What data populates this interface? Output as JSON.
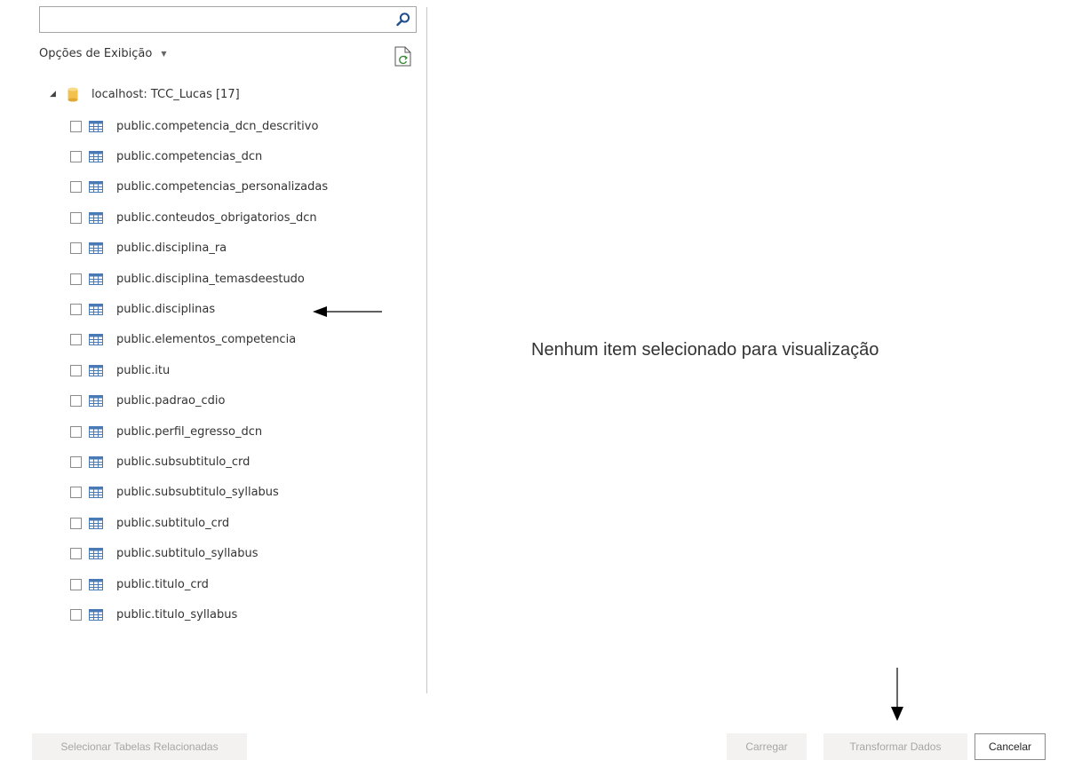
{
  "search": {
    "value": "",
    "placeholder": ""
  },
  "display_options": {
    "label": "Opções de Exibição"
  },
  "tree": {
    "root_label": "localhost: TCC_Lucas [17]",
    "tables": [
      "public.competencia_dcn_descritivo",
      "public.competencias_dcn",
      "public.competencias_personalizadas",
      "public.conteudos_obrigatorios_dcn",
      "public.disciplina_ra",
      "public.disciplina_temasdeestudo",
      "public.disciplinas",
      "public.elementos_competencia",
      "public.itu",
      "public.padrao_cdio",
      "public.perfil_egresso_dcn",
      "public.subsubtitulo_crd",
      "public.subsubtitulo_syllabus",
      "public.subtitulo_crd",
      "public.subtitulo_syllabus",
      "public.titulo_crd",
      "public.titulo_syllabus"
    ]
  },
  "preview": {
    "empty_message": "Nenhum item selecionado para visualização"
  },
  "footer": {
    "select_related_label": "Selecionar Tabelas Relacionadas",
    "load_label": "Carregar",
    "transform_label": "Transformar Dados",
    "cancel_label": "Cancelar"
  },
  "colors": {
    "table_icon": "#4a7ab5",
    "db_icon": "#f2c14e",
    "disabled_bg": "#f3f2f1"
  },
  "icons": {
    "search": "search-icon",
    "refresh": "refresh-icon",
    "expand": "expand-triangle-icon",
    "database": "database-icon",
    "table": "table-icon"
  }
}
